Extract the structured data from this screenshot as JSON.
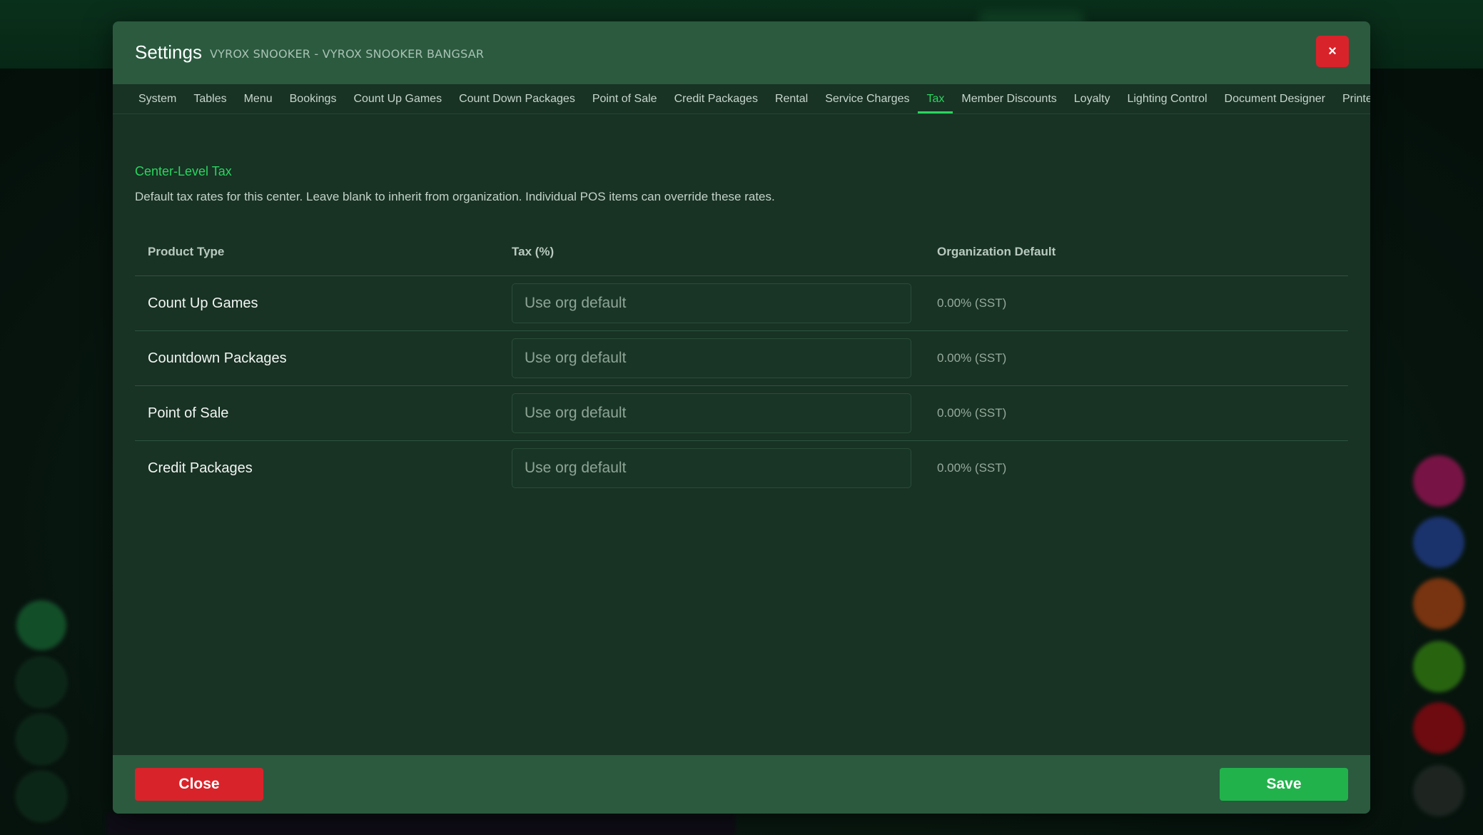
{
  "modal": {
    "title": "Settings",
    "subtitle": "VYROX SNOOKER - VYROX SNOOKER BANGSAR",
    "close_icon": "×"
  },
  "tabs": [
    {
      "label": "System",
      "active": false
    },
    {
      "label": "Tables",
      "active": false
    },
    {
      "label": "Menu",
      "active": false
    },
    {
      "label": "Bookings",
      "active": false
    },
    {
      "label": "Count Up Games",
      "active": false
    },
    {
      "label": "Count Down Packages",
      "active": false
    },
    {
      "label": "Point of Sale",
      "active": false
    },
    {
      "label": "Credit Packages",
      "active": false
    },
    {
      "label": "Rental",
      "active": false
    },
    {
      "label": "Service Charges",
      "active": false
    },
    {
      "label": "Tax",
      "active": true
    },
    {
      "label": "Member Discounts",
      "active": false
    },
    {
      "label": "Loyalty",
      "active": false
    },
    {
      "label": "Lighting Control",
      "active": false
    },
    {
      "label": "Document Designer",
      "active": false
    },
    {
      "label": "Printers",
      "active": false
    }
  ],
  "section": {
    "title": "Center-Level Tax",
    "description": "Default tax rates for this center. Leave blank to inherit from organization. Individual POS items can override these rates."
  },
  "table": {
    "headers": {
      "product_type": "Product Type",
      "tax": "Tax (%)",
      "org_default": "Organization Default"
    },
    "rows": [
      {
        "product_type": "Count Up Games",
        "tax_value": "",
        "placeholder": "Use org default",
        "org_default": "0.00% (SST)"
      },
      {
        "product_type": "Countdown Packages",
        "tax_value": "",
        "placeholder": "Use org default",
        "org_default": "0.00% (SST)"
      },
      {
        "product_type": "Point of Sale",
        "tax_value": "",
        "placeholder": "Use org default",
        "org_default": "0.00% (SST)"
      },
      {
        "product_type": "Credit Packages",
        "tax_value": "",
        "placeholder": "Use org default",
        "org_default": "0.00% (SST)"
      }
    ]
  },
  "footer": {
    "close_label": "Close",
    "save_label": "Save"
  },
  "colors": {
    "accent": "#2bd55f",
    "danger": "#d9232a",
    "success": "#22b24c",
    "header_bg": "#2b5a3f",
    "modal_bg": "#183224"
  },
  "background_buttons": {
    "left": [
      "status-icon",
      "status-icon",
      "status-icon",
      "status-icon"
    ],
    "right": [
      {
        "icon": "app-icon",
        "color": "#b8206a"
      },
      {
        "icon": "app-icon",
        "color": "#2a4fa8"
      },
      {
        "icon": "app-icon",
        "color": "#b8501a"
      },
      {
        "icon": "app-icon",
        "color": "#3e9a1a"
      },
      {
        "icon": "app-icon",
        "color": "#a8121a"
      },
      {
        "icon": "app-icon",
        "color": "#2e3a34"
      }
    ]
  }
}
